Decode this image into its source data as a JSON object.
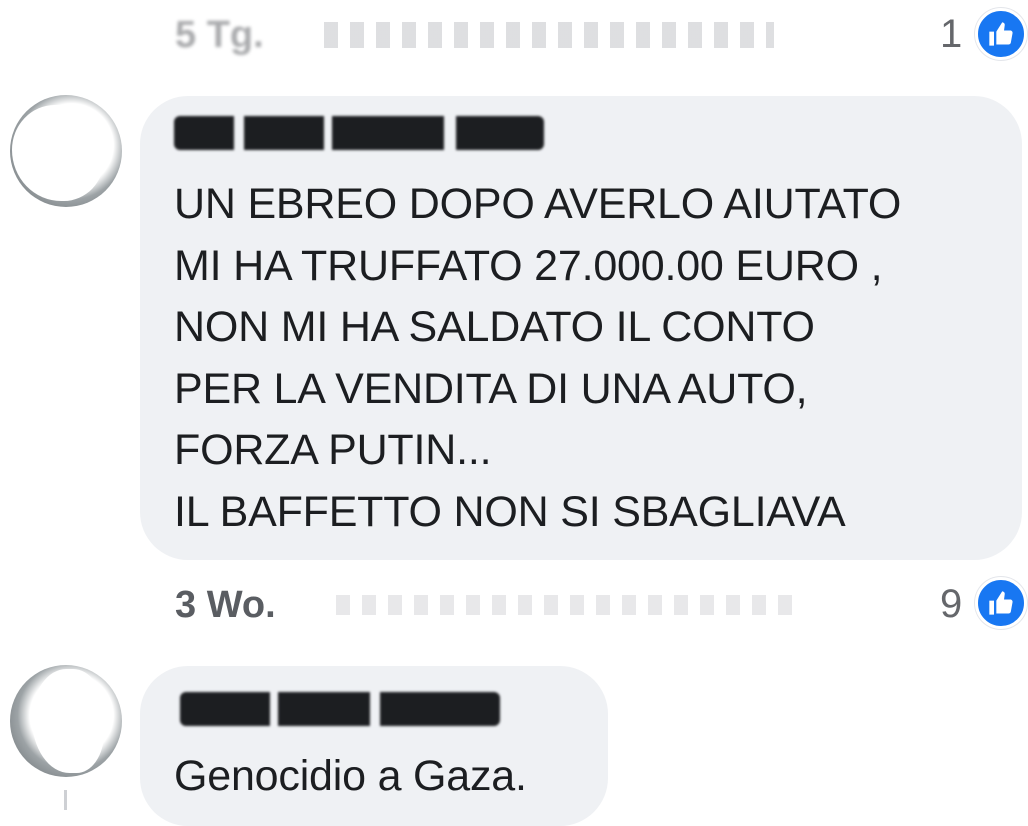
{
  "previous_comment": {
    "time": "5 Tg.",
    "like_count": "1"
  },
  "comments": [
    {
      "text_lines": [
        "UN EBREO DOPO AVERLO AIUTATO",
        "MI HA TRUFFATO 27.000.00 EURO ,",
        "NON MI HA SALDATO IL CONTO",
        "PER LA VENDITA DI UNA AUTO,",
        "FORZA PUTIN...",
        "IL BAFFETTO NON SI SBAGLIAVA"
      ],
      "time": "3 Wo.",
      "like_count": "9"
    },
    {
      "text_lines": [
        "Genocidio a Gaza."
      ]
    }
  ],
  "colors": {
    "bubble": "#eff1f4",
    "like_badge": "#1877f2",
    "meta_text": "#65676b"
  },
  "icons": [
    "thumbs-up-icon",
    "avatar"
  ]
}
